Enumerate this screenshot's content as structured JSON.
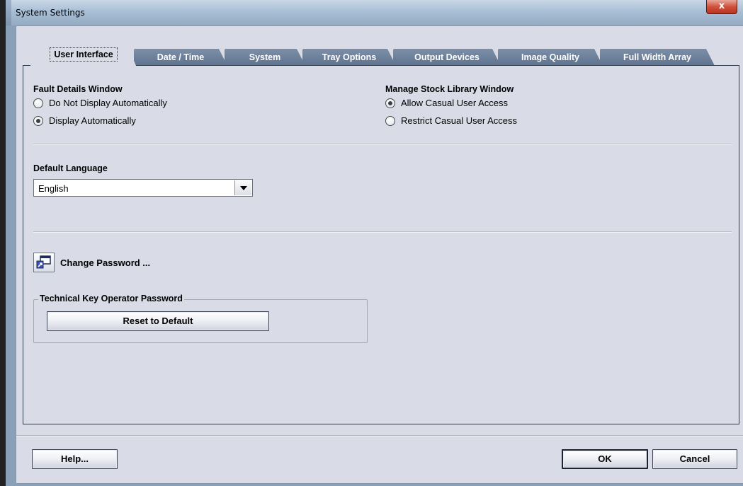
{
  "window": {
    "title": "System Settings",
    "close_label": "x"
  },
  "tabs": [
    {
      "label": "User Interface",
      "active": true
    },
    {
      "label": "Date / Time",
      "active": false
    },
    {
      "label": "System",
      "active": false
    },
    {
      "label": "Tray Options",
      "active": false
    },
    {
      "label": "Output Devices",
      "active": false
    },
    {
      "label": "Image Quality",
      "active": false
    },
    {
      "label": "Full Width Array",
      "active": false
    }
  ],
  "fault_details": {
    "heading": "Fault Details Window",
    "options": [
      {
        "label": "Do Not Display Automatically",
        "selected": false
      },
      {
        "label": "Display Automatically",
        "selected": true
      }
    ]
  },
  "stock_library": {
    "heading": "Manage Stock Library Window",
    "options": [
      {
        "label": "Allow Casual User Access",
        "selected": true
      },
      {
        "label": "Restrict Casual User Access",
        "selected": false
      }
    ]
  },
  "default_language": {
    "heading": "Default Language",
    "selected": "English"
  },
  "change_password": {
    "label": "Change Password ..."
  },
  "tko_password": {
    "legend": "Technical Key Operator Password",
    "reset_label": "Reset to Default"
  },
  "footer": {
    "help_label": "Help...",
    "ok_label": "OK",
    "cancel_label": "Cancel"
  },
  "colors": {
    "panel_bg": "#d9dce6",
    "tab_inactive": "#6a7d99",
    "title_gradient_top": "#c9d7e6"
  }
}
